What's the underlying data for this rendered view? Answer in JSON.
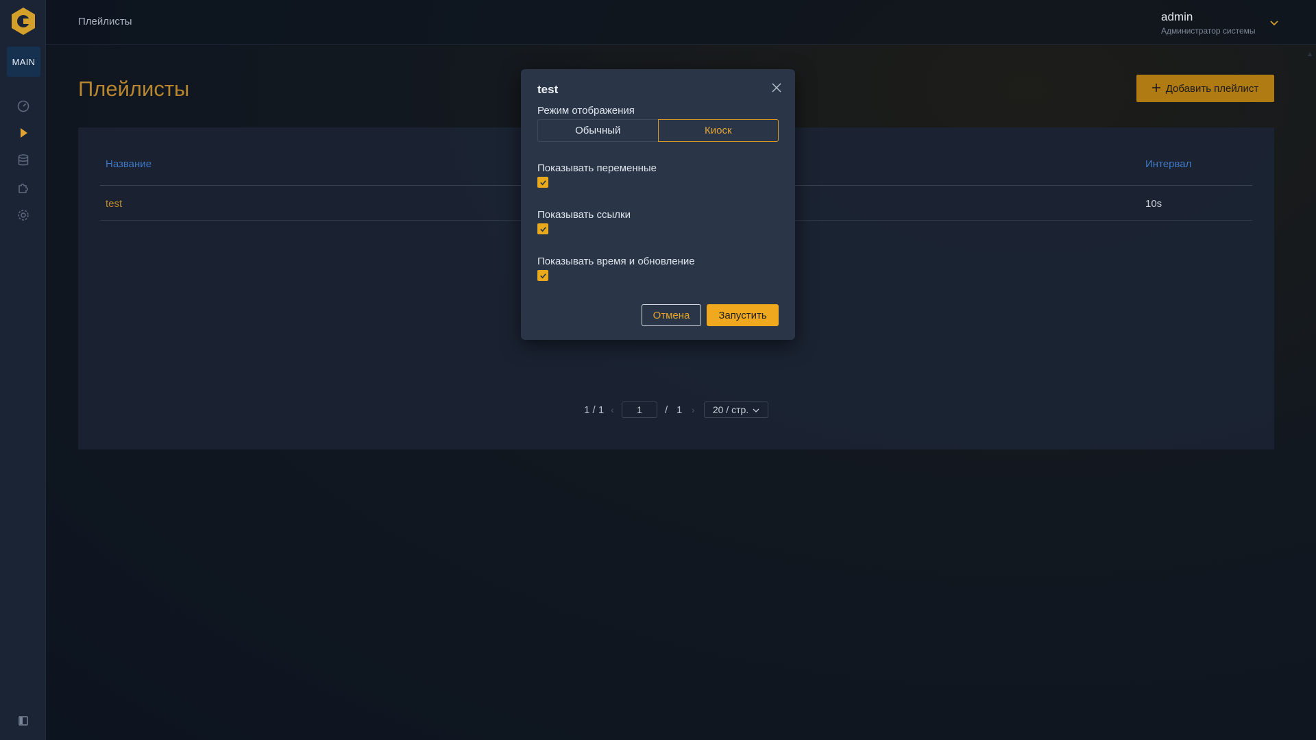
{
  "colors": {
    "accent": "#f0a91e",
    "title": "#b8862e",
    "link_blue": "#3f78c4",
    "sidebar_bg": "#1b2434",
    "modal_bg": "#2a3648"
  },
  "sidebar": {
    "badge": "MAIN",
    "items": [
      {
        "icon": "dashboard-gauge-icon"
      },
      {
        "icon": "play-icon"
      },
      {
        "icon": "database-icon"
      },
      {
        "icon": "puzzle-plugin-icon"
      },
      {
        "icon": "gear-icon"
      }
    ],
    "collapse_icon": "sidebar-toggle-icon"
  },
  "topbar": {
    "breadcrumb": "Плейлисты",
    "user_name": "admin",
    "user_role": "Администратор системы"
  },
  "page": {
    "title": "Плейлисты",
    "add_button": "Добавить плейлист"
  },
  "table": {
    "columns": [
      "Название",
      "Интервал"
    ],
    "rows": [
      {
        "name": "test",
        "interval": "10s"
      }
    ]
  },
  "pagination": {
    "summary": "1 / 1",
    "current_page": "1",
    "separator": "/",
    "total_pages": "1",
    "page_size": "20 / стр."
  },
  "modal": {
    "title": "test",
    "mode_label": "Режим отображения",
    "mode_options": [
      "Обычный",
      "Киоск"
    ],
    "mode_selected": "Киоск",
    "options": [
      {
        "label": "Показывать переменные",
        "checked": true
      },
      {
        "label": "Показывать ссылки",
        "checked": true
      },
      {
        "label": "Показывать время и обновление",
        "checked": true
      }
    ],
    "cancel": "Отмена",
    "submit": "Запустить"
  }
}
